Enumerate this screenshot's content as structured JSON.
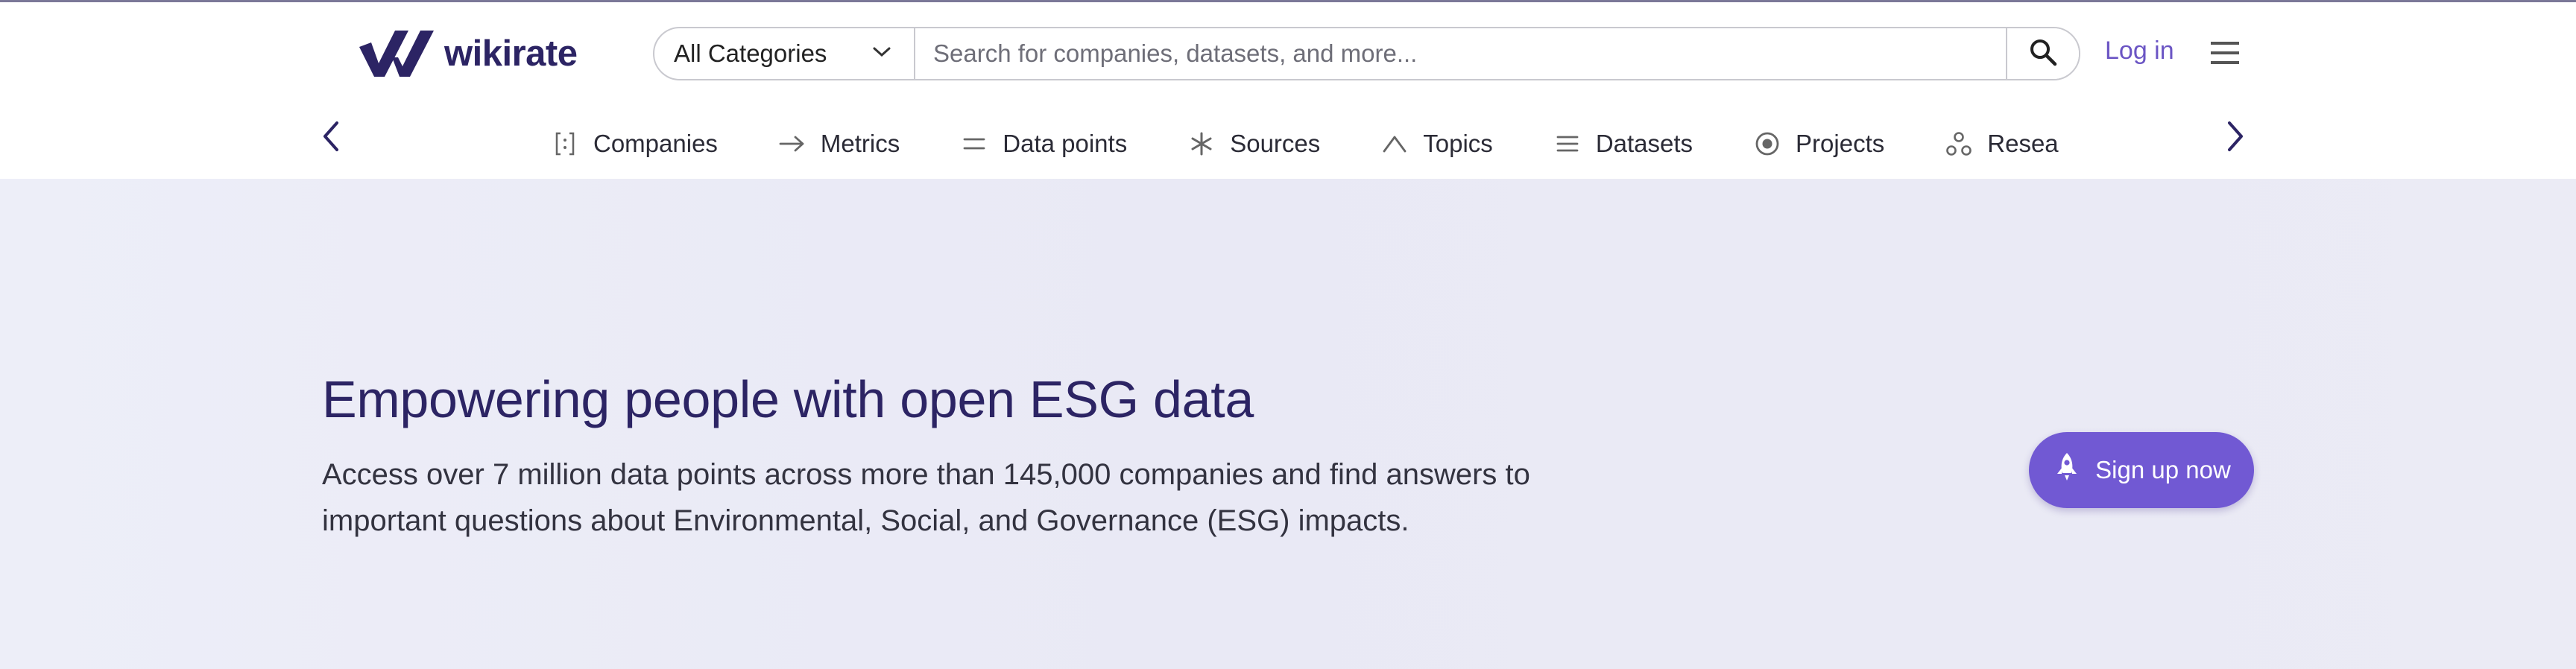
{
  "header": {
    "logo_text": "wikirate",
    "category_select": {
      "selected": "All Categories"
    },
    "search": {
      "placeholder": "Search for companies, datasets, and more..."
    },
    "login_label": "Log in"
  },
  "nav": {
    "items": [
      {
        "label": "Companies",
        "icon": "companies-icon"
      },
      {
        "label": "Metrics",
        "icon": "arrow-right-icon"
      },
      {
        "label": "Data points",
        "icon": "equals-icon"
      },
      {
        "label": "Sources",
        "icon": "asterisk-icon"
      },
      {
        "label": "Topics",
        "icon": "caret-up-icon"
      },
      {
        "label": "Datasets",
        "icon": "list-icon"
      },
      {
        "label": "Projects",
        "icon": "radio-icon"
      },
      {
        "label": "Resea",
        "icon": "research-icon"
      }
    ]
  },
  "hero": {
    "title": "Empowering people with open ESG data",
    "subtitle": "Access over 7 million data points across more than 145,000 companies and find answers to important questions about Environmental, Social, and Governance (ESG) impacts.",
    "cta_label": "Sign up now"
  },
  "colors": {
    "brand": "#2c2464",
    "accent": "#7159d3",
    "link": "#6b55c4",
    "hero_bg": "#ebebf5"
  }
}
